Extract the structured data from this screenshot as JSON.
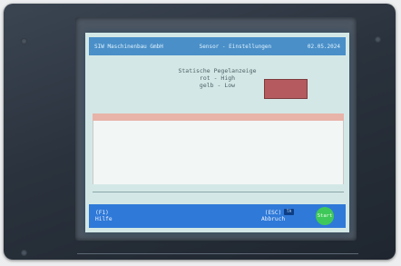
{
  "header": {
    "company": "SIW Maschinenbau GmbH",
    "section": "Sensor - Einstellungen",
    "date": "02.05.2024"
  },
  "main": {
    "title": "Statische Pegelanzeige",
    "line_rot": "rot  - High",
    "line_gelb": "gelb - Low"
  },
  "footer": {
    "help_key": "(F1)",
    "help_label": "Hilfe",
    "esc_key": "(ESC)",
    "esc_tag": "TA",
    "esc_label": "Abbruch",
    "start_label": "Start"
  },
  "colors": {
    "indicator": "#b55a5e",
    "footer": "#2f79d8",
    "start": "#3fc85a"
  }
}
